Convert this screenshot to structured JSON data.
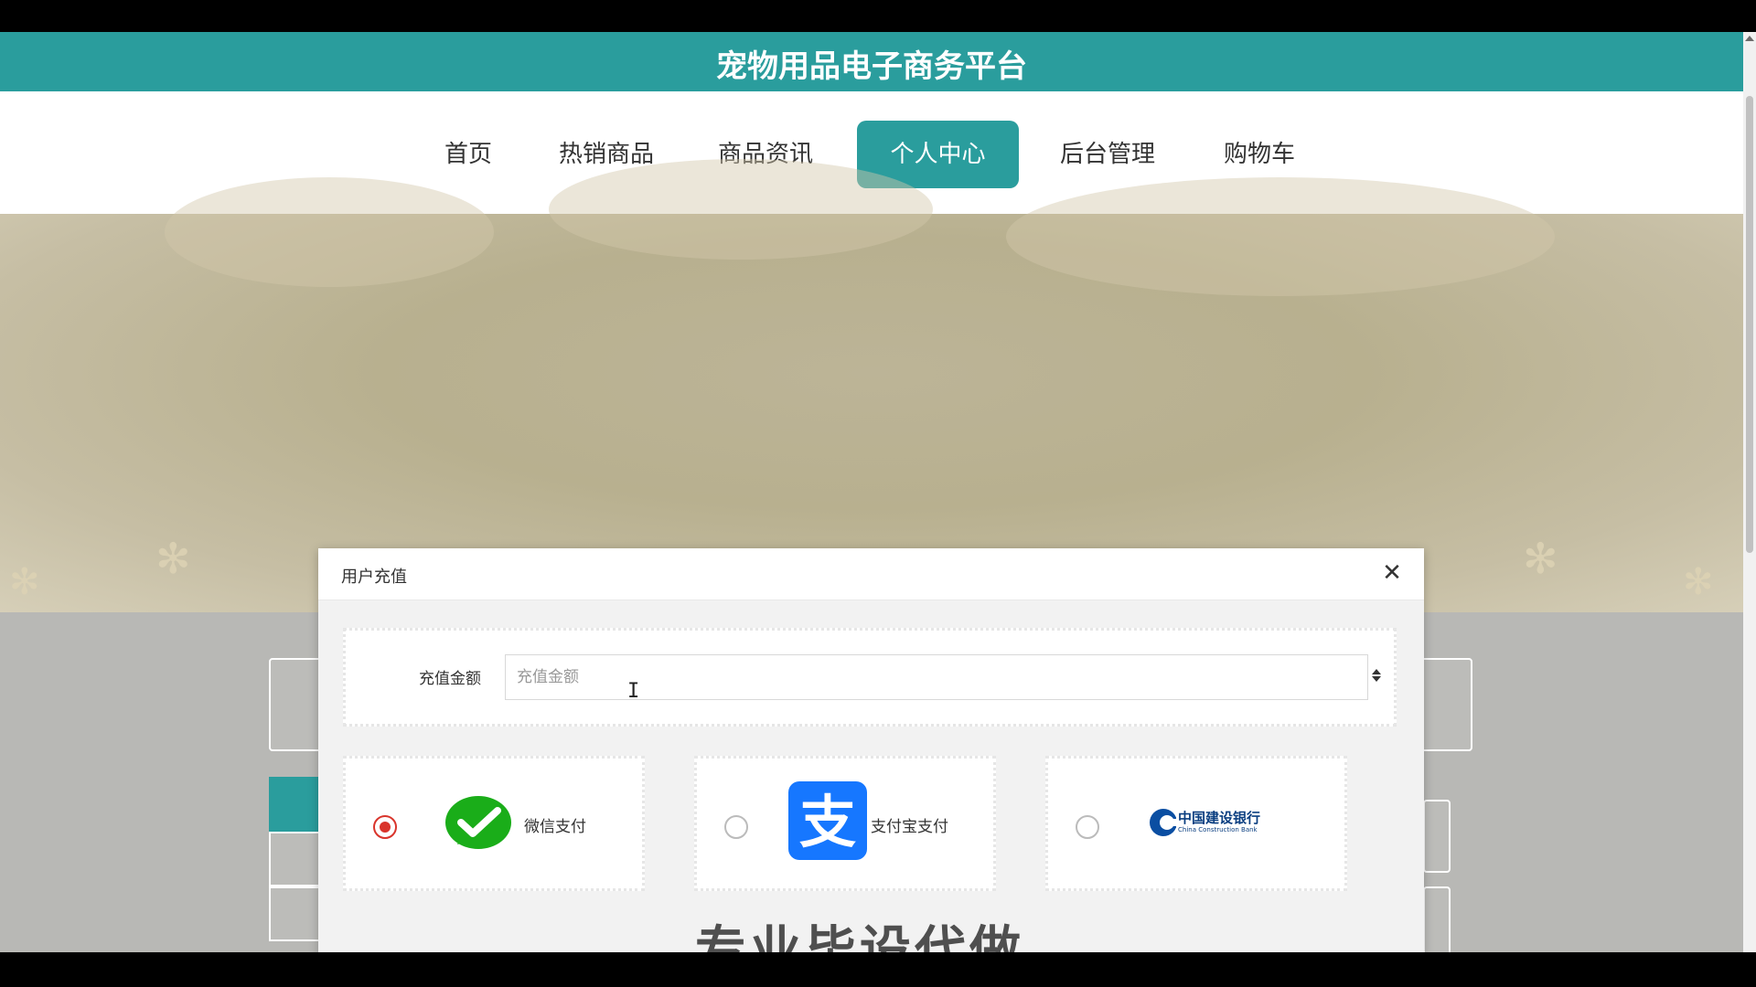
{
  "header": {
    "site_title": "宠物用品电子商务平台"
  },
  "nav": {
    "items": [
      {
        "label": "首页",
        "active": false
      },
      {
        "label": "热销商品",
        "active": false
      },
      {
        "label": "商品资讯",
        "active": false
      },
      {
        "label": "个人中心",
        "active": true
      },
      {
        "label": "后台管理",
        "active": false
      },
      {
        "label": "购物车",
        "active": false
      }
    ]
  },
  "modal": {
    "title": "用户充值",
    "close_icon": "close-icon",
    "amount": {
      "label": "充值金额",
      "placeholder": "充值金额",
      "value": ""
    },
    "payment_options": [
      {
        "label": "微信支付",
        "icon": "wechat-pay-icon",
        "selected": true
      },
      {
        "label": "支付宝支付",
        "icon": "alipay-icon",
        "selected": false
      },
      {
        "label": "中国建设银行",
        "sublabel": "China Construction Bank",
        "icon": "ccb-logo",
        "selected": false
      }
    ]
  },
  "overlay_text": "专业毕设代做",
  "colors": {
    "primary": "#2a9d9d",
    "radio_selected": "#d9342b",
    "wechat_green": "#1aad19",
    "alipay_blue": "#1677ff",
    "ccb_blue": "#0a4ea2"
  }
}
